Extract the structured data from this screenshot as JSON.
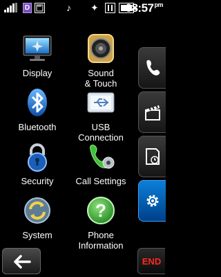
{
  "status_bar": {
    "ico_d": "D",
    "time": "08:57",
    "time_suffix": "pm"
  },
  "settings": [
    {
      "label_1": "Display",
      "label_2": "",
      "icon": "monitor-icon"
    },
    {
      "label_1": "Sound",
      "label_2": "& Touch",
      "icon": "speaker-icon"
    },
    {
      "label_1": "Bluetooth",
      "label_2": "",
      "icon": "bluetooth-icon"
    },
    {
      "label_1": "USB",
      "label_2": "Connection",
      "icon": "usb-icon"
    },
    {
      "label_1": "Security",
      "label_2": "",
      "icon": "padlock-icon"
    },
    {
      "label_1": "Call Settings",
      "label_2": "",
      "icon": "phone-gear-icon"
    },
    {
      "label_1": "System",
      "label_2": "",
      "icon": "sync-arrows-icon"
    },
    {
      "label_1": "Phone",
      "label_2": "Information",
      "icon": "help-icon"
    }
  ],
  "rail_tabs": [
    {
      "icon": "phone-icon",
      "active": false
    },
    {
      "icon": "clapperboard-icon",
      "active": false
    },
    {
      "icon": "document-clock-icon",
      "active": false
    },
    {
      "icon": "gear-icon",
      "active": true
    }
  ],
  "end_label": "END",
  "colors": {
    "accent": "#0a7fd8",
    "end_text": "#ff2a1a",
    "background": "#000000"
  }
}
